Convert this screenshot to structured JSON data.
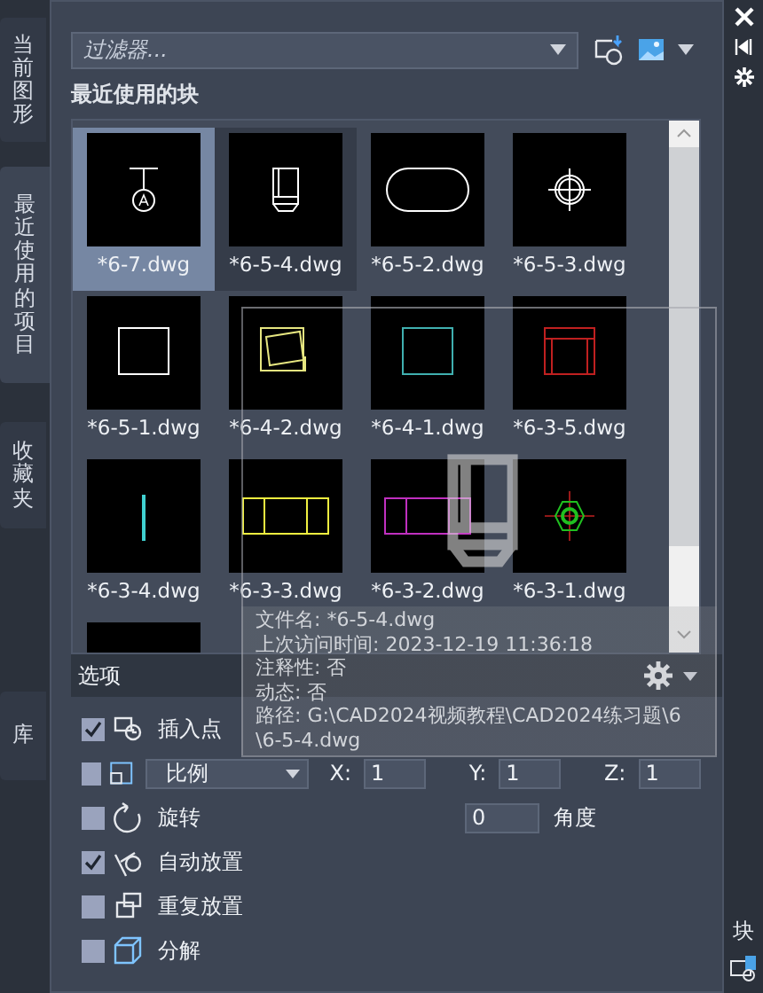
{
  "tabs": [
    {
      "label": "当前图形",
      "selected": false
    },
    {
      "label": "最近使用的项目",
      "selected": true
    },
    {
      "label": "收藏夹",
      "selected": false
    },
    {
      "label": "库",
      "selected": false
    }
  ],
  "filter": {
    "placeholder": "过滤器..."
  },
  "section_title": "最近使用的块",
  "blocks": [
    {
      "label": "*6-7.dwg",
      "kind": "valve",
      "color": "#ffffff",
      "selected": true,
      "hovered": false
    },
    {
      "label": "*6-5-4.dwg",
      "kind": "cup",
      "color": "#ffffff",
      "selected": false,
      "hovered": true
    },
    {
      "label": "*6-5-2.dwg",
      "kind": "slot",
      "color": "#ffffff",
      "selected": false,
      "hovered": false
    },
    {
      "label": "*6-5-3.dwg",
      "kind": "crosshair",
      "color": "#ffffff",
      "selected": false,
      "hovered": false
    },
    {
      "label": "*6-5-1.dwg",
      "kind": "square",
      "color": "#ffffff",
      "selected": false,
      "hovered": false
    },
    {
      "label": "*6-4-2.dwg",
      "kind": "tilted",
      "color": "#e6e680",
      "selected": false,
      "hovered": false
    },
    {
      "label": "*6-4-1.dwg",
      "kind": "square",
      "color": "#40b0b0",
      "selected": false,
      "hovered": false
    },
    {
      "label": "*6-3-5.dwg",
      "kind": "chair",
      "color": "#c02020",
      "selected": false,
      "hovered": false
    },
    {
      "label": "*6-3-4.dwg",
      "kind": "line",
      "color": "#40d0d0",
      "selected": false,
      "hovered": false
    },
    {
      "label": "*6-3-3.dwg",
      "kind": "triple",
      "color": "#f0f040",
      "selected": false,
      "hovered": false
    },
    {
      "label": "*6-3-2.dwg",
      "kind": "triple",
      "color": "#c030c0",
      "selected": false,
      "hovered": false
    },
    {
      "label": "*6-3-1.dwg",
      "kind": "nut",
      "color": "#20c020",
      "selected": false,
      "hovered": false
    },
    {
      "kind": "cut",
      "selected": false,
      "hovered": false
    }
  ],
  "tooltip": {
    "lines": [
      "文件名: *6-5-4.dwg",
      "上次访问时间: 2023-12-19 11:36:18",
      "注释性: 否",
      "动态: 否",
      "路径: G:\\CAD2024视频教程\\CAD2024练习题\\6",
      "\\6-5-4.dwg"
    ]
  },
  "options": {
    "title": "选项",
    "rows": [
      {
        "kind": "check",
        "label": "插入点",
        "checked": true
      },
      {
        "kind": "scale",
        "checked": false,
        "dropdown": "比例",
        "fields": [
          {
            "label": "X:",
            "value": "1"
          },
          {
            "label": "Y:",
            "value": "1"
          },
          {
            "label": "Z:",
            "value": "1"
          }
        ]
      },
      {
        "kind": "rotate",
        "label": "旋转",
        "checked": false,
        "value": "0",
        "unit": "角度"
      },
      {
        "kind": "check",
        "label": "自动放置",
        "checked": true
      },
      {
        "kind": "check",
        "label": "重复放置",
        "checked": false
      },
      {
        "kind": "check",
        "label": "分解",
        "checked": false
      }
    ]
  },
  "side_label": "块"
}
